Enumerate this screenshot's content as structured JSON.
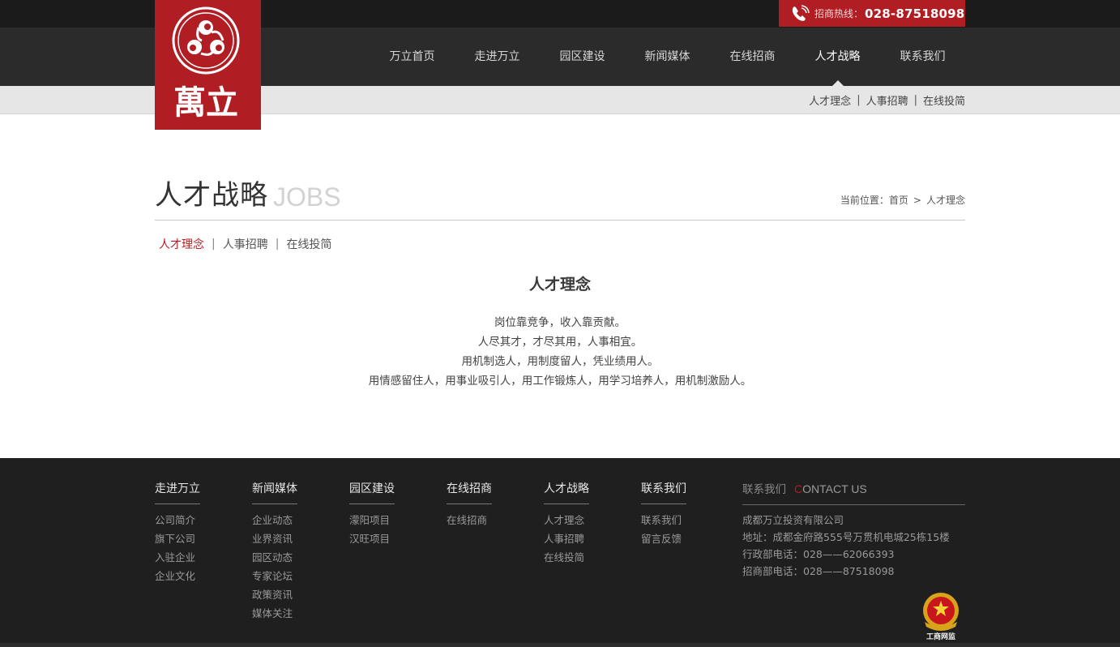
{
  "header": {
    "logo_text": "萬立",
    "hotline_label": "招商热线：",
    "hotline_number": "028-87518098"
  },
  "nav": {
    "items": [
      {
        "label": "万立首页"
      },
      {
        "label": "走进万立"
      },
      {
        "label": "园区建设"
      },
      {
        "label": "新闻媒体"
      },
      {
        "label": "在线招商"
      },
      {
        "label": "人才战略",
        "active": true
      },
      {
        "label": "联系我们"
      }
    ]
  },
  "subnav": {
    "items": [
      "人才理念",
      "人事招聘",
      "在线投简"
    ],
    "separator": "|"
  },
  "page": {
    "title_cn": "人才战略",
    "title_en": "JOBS",
    "breadcrumb": {
      "prefix": "当前位置：",
      "home": "首页",
      "arrow": ">",
      "current": "人才理念"
    }
  },
  "tabs": {
    "items": [
      {
        "label": "人才理念",
        "active": true
      },
      {
        "label": "人事招聘"
      },
      {
        "label": "在线投简"
      }
    ],
    "separator": "|"
  },
  "content": {
    "title": "人才理念",
    "lines": [
      "岗位靠竞争，收入靠贡献。",
      "人尽其才，才尽其用，人事相宜。",
      "用机制选人，用制度留人，凭业绩用人。",
      "用情感留住人，用事业吸引人，用工作锻炼人，用学习培养人，用机制激励人。"
    ]
  },
  "footer": {
    "columns": [
      {
        "title": "走进万立",
        "links": [
          "公司简介",
          "旗下公司",
          "入驻企业",
          "企业文化"
        ]
      },
      {
        "title": "新闻媒体",
        "links": [
          "企业动态",
          "业界资讯",
          "园区动态",
          "专家论坛",
          "政策资讯",
          "媒体关注"
        ]
      },
      {
        "title": "园区建设",
        "links": [
          "濛阳项目",
          "汉旺项目"
        ]
      },
      {
        "title": "在线招商",
        "links": [
          "在线招商"
        ]
      },
      {
        "title": "人才战略",
        "links": [
          "人才理念",
          "人事招聘",
          "在线投简"
        ]
      },
      {
        "title": "联系我们",
        "links": [
          "联系我们",
          "留言反馈"
        ]
      }
    ],
    "contact": {
      "title_cn": "联系我们",
      "title_en_accent": "C",
      "title_en_rest": "ONTACT US",
      "company": "成都万立投资有限公司",
      "address": "地址：成都金府路555号万贯机电城25栋15楼",
      "admin_phone": "行政部电话：028——62066393",
      "biz_phone": "招商部电话：028——87518098"
    },
    "badge_text": "工商网监"
  },
  "colors": {
    "brand_red": "#b01e23",
    "dark_bg": "#2b2b2b",
    "footer_bg": "#1f1f1f"
  }
}
